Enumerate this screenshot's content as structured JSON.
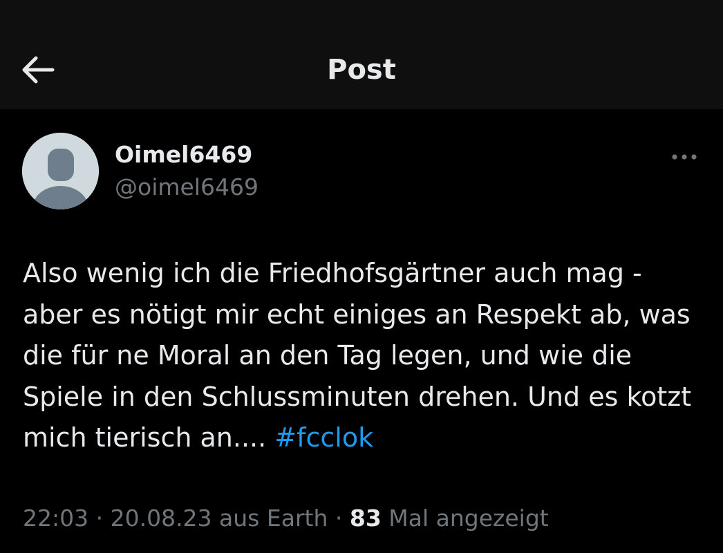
{
  "header": {
    "title": "Post",
    "back_icon": "arrow-left-icon"
  },
  "author": {
    "display_name": "Oimel6469",
    "handle": "@oimel6469",
    "avatar_icon": "default-avatar-icon"
  },
  "more_icon": "more-horizontal-icon",
  "post": {
    "lines": [
      "Also wenig ich die Friedhofsgärtner auch mag -",
      "aber es nötigt mir echt einiges an Respekt ab, was",
      "die für ne Moral an den Tag legen, und wie die",
      "Spiele in den Schlussminuten drehen. Und es kotzt"
    ],
    "last_line_text": "mich tierisch an....",
    "hashtag": "#fcclok"
  },
  "meta": {
    "time": "22:03",
    "separator": " · ",
    "date": "20.08.23",
    "location": "aus Earth",
    "views_count": "83",
    "views_label": "Mal angezeigt"
  },
  "colors": {
    "background": "#000000",
    "header_background": "#0f0f0f",
    "text_primary": "#e7e9ea",
    "text_secondary": "#71767b",
    "accent": "#1d9bf0",
    "avatar_background": "#cfd9de",
    "avatar_figure": "#6e7e8c"
  }
}
